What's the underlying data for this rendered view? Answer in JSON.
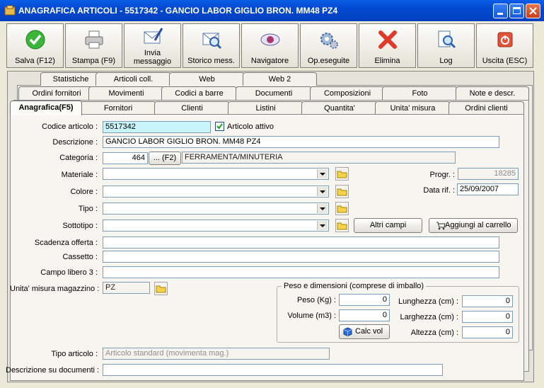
{
  "window": {
    "title": "ANAGRAFICA ARTICOLI - 5517342 - GANCIO LABOR  GIGLIO BRON. MM48 PZ4"
  },
  "toolbar": {
    "save": "Salva (F12)",
    "print": "Stampa (F9)",
    "send_1": "Invia",
    "send_2": "messaggio",
    "history": "Storico mess.",
    "navigator": "Navigatore",
    "ops": "Op.eseguite",
    "delete": "Elimina",
    "log": "Log",
    "exit": "Uscita (ESC)"
  },
  "tabs": {
    "row1": [
      "Statistiche",
      "Articoli coll.",
      "Web",
      "Web 2"
    ],
    "row2": [
      "Ordini fornitori",
      "Movimenti",
      "Codici a barre",
      "Documenti",
      "Composizioni",
      "Foto",
      "Note e descr."
    ],
    "row3": [
      "Anagrafica(F5)",
      "Fornitori",
      "Clienti",
      "Listini",
      "Quantita'",
      "Unita' misura",
      "Ordini clienti"
    ]
  },
  "form": {
    "code_label": "Codice articolo :",
    "code_value": "5517342",
    "active_label": "Articolo attivo",
    "active_checked": true,
    "desc_label": "Descrizione :",
    "desc_value": "GANCIO LABOR  GIGLIO BRON. MM48 PZ4",
    "cat_label": "Categoria :",
    "cat_code": "464",
    "cat_btn": "... (F2)",
    "cat_name": "FERRAMENTA/MINUTERIA",
    "material_label": "Materiale :",
    "color_label": "Colore :",
    "type_label": "Tipo :",
    "subtype_label": "Sottotipo :",
    "prog_label": "Progr. :",
    "prog_value": "18285",
    "date_label": "Data rif. :",
    "date_value": "25/09/2007",
    "other_fields_btn": "Altri campi",
    "add_cart_btn": "Aggiungi al carrello",
    "offer_label": "Scadenza offerta :",
    "drawer_label": "Cassetto :",
    "free3_label": "Campo libero 3 :",
    "uom_label": "Unita' misura magazzino :",
    "uom_value": "PZ",
    "weight_group": "Peso e dimensioni (comprese di imballo)",
    "weight_label": "Peso (Kg) :",
    "weight_value": "0",
    "volume_label": "Volume (m3) :",
    "volume_value": "0",
    "calc_btn": "Calc vol",
    "length_label": "Lunghezza (cm) :",
    "length_value": "0",
    "width_label": "Larghezza (cm) :",
    "width_value": "0",
    "height_label": "Altezza (cm) :",
    "height_value": "0",
    "article_type_label": "Tipo articolo :",
    "article_type_value": "Articolo standard (movimenta mag.)",
    "doc_desc_label": "Descrizione su documenti :"
  }
}
